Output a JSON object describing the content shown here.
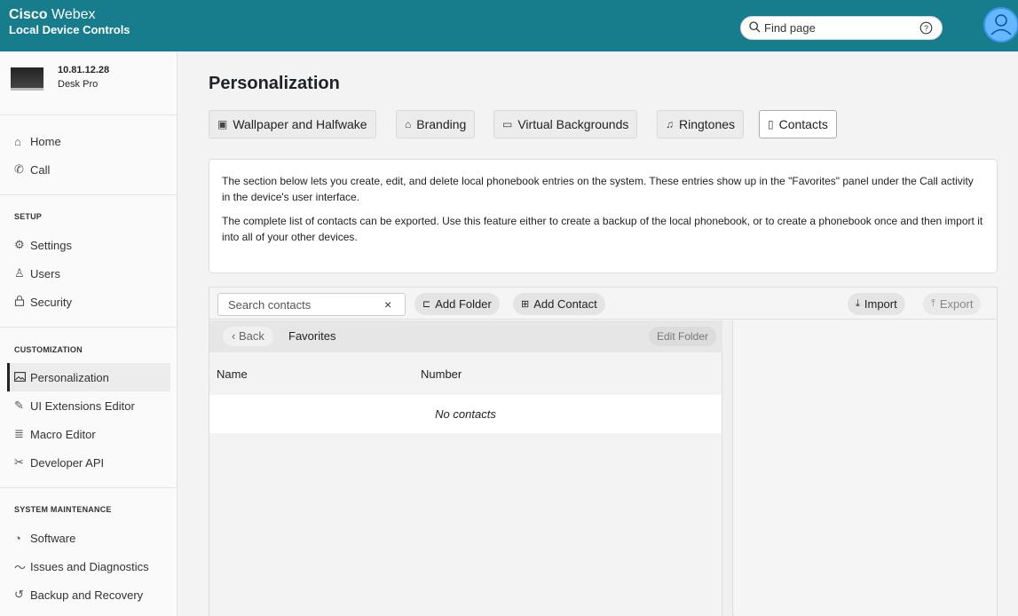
{
  "header": {
    "brand_bold": "Cisco",
    "brand_light": "Webex",
    "subtitle": "Local Device Controls",
    "search_placeholder": "Find page"
  },
  "device": {
    "ip": "10.81.12.28",
    "model": "Desk Pro"
  },
  "sidebar": {
    "top_items": [
      {
        "label": "Home",
        "icon": "home-icon"
      },
      {
        "label": "Call",
        "icon": "phone-icon"
      }
    ],
    "setup_label": "SETUP",
    "setup_items": [
      {
        "label": "Settings",
        "icon": "gear-icon"
      },
      {
        "label": "Users",
        "icon": "user-icon"
      },
      {
        "label": "Security",
        "icon": "lock-icon"
      }
    ],
    "customization_label": "CUSTOMIZATION",
    "customization_items": [
      {
        "label": "Personalization",
        "icon": "image-icon"
      },
      {
        "label": "UI Extensions Editor",
        "icon": "pencil-icon"
      },
      {
        "label": "Macro Editor",
        "icon": "lines-icon"
      },
      {
        "label": "Developer API",
        "icon": "tools-icon"
      }
    ],
    "maintenance_label": "SYSTEM MAINTENANCE",
    "maintenance_items": [
      {
        "label": "Software",
        "icon": "software-icon"
      },
      {
        "label": "Issues and Diagnostics",
        "icon": "pulse-icon"
      },
      {
        "label": "Backup and Recovery",
        "icon": "history-icon"
      }
    ]
  },
  "page": {
    "title": "Personalization",
    "tabs": [
      {
        "label": "Wallpaper and Halfwake",
        "icon": "image-icon"
      },
      {
        "label": "Branding",
        "icon": "tag-icon"
      },
      {
        "label": "Virtual Backgrounds",
        "icon": "screen-icon"
      },
      {
        "label": "Ringtones",
        "icon": "music-icon"
      },
      {
        "label": "Contacts",
        "icon": "contact-book-icon",
        "active": true
      }
    ],
    "info_p1": "The section below lets you create, edit, and delete local phonebook entries on the system. These entries show up in the \"Favorites\" panel under the Call activity in the device's user interface.",
    "info_p2": "The complete list of contacts can be exported. Use this feature either to create a backup of the local phonebook, or to create a phonebook once and then import it into all of your other devices."
  },
  "contacts": {
    "search_placeholder": "Search contacts",
    "clear": "×",
    "add_folder": "Add Folder",
    "add_contact": "Add Contact",
    "import": "Import",
    "export": "Export",
    "back": "Back",
    "breadcrumb": "Favorites",
    "edit_folder": "Edit Folder",
    "col_name": "Name",
    "col_number": "Number",
    "empty": "No contacts"
  }
}
